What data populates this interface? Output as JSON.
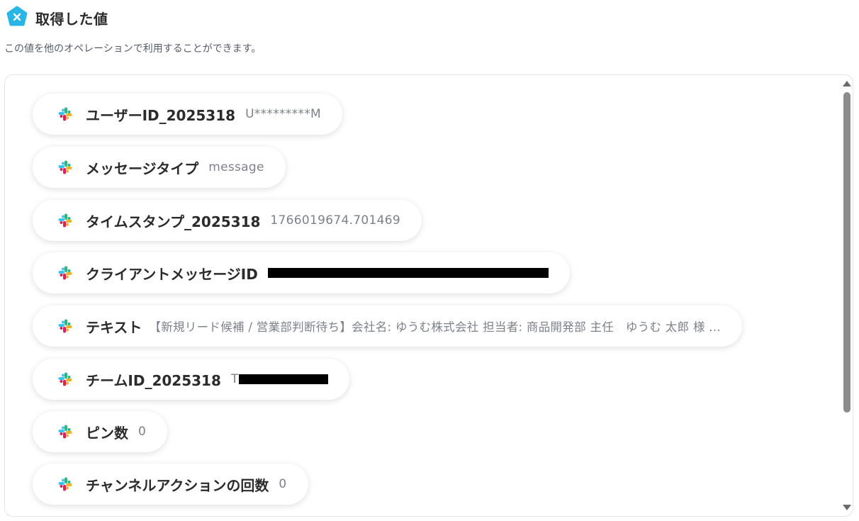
{
  "header": {
    "title": "取得した値",
    "subtitle": "この値を他のオペレーションで利用することができます。"
  },
  "items": [
    {
      "icon": "slack-icon",
      "label": "ユーザーID_2025318",
      "value": "U*********M"
    },
    {
      "icon": "slack-icon",
      "label": "メッセージタイプ",
      "value": "message"
    },
    {
      "icon": "slack-icon",
      "label": "タイムスタンプ_2025318",
      "value": "1766019674.701469"
    },
    {
      "icon": "slack-icon",
      "label": "クライアントメッセージID",
      "value": ""
    },
    {
      "icon": "slack-icon",
      "label": "テキスト",
      "value": "【新規リード候補 / 営業部判断待ち】会社名: ゆうむ株式会社 担当者: 商品開発部 主任　ゆうむ 太郎 様 ..."
    },
    {
      "icon": "slack-icon",
      "label": "チームID_2025318",
      "value": "T"
    },
    {
      "icon": "slack-icon",
      "label": "ピン数",
      "value": "0"
    },
    {
      "icon": "slack-icon",
      "label": "チャンネルアクションの回数",
      "value": "0"
    }
  ],
  "colors": {
    "brand": "#29b6e6",
    "slack_blue": "#36c5f0",
    "slack_green": "#2eb67d",
    "slack_yellow": "#ecb22e",
    "slack_red": "#e01e5a"
  }
}
